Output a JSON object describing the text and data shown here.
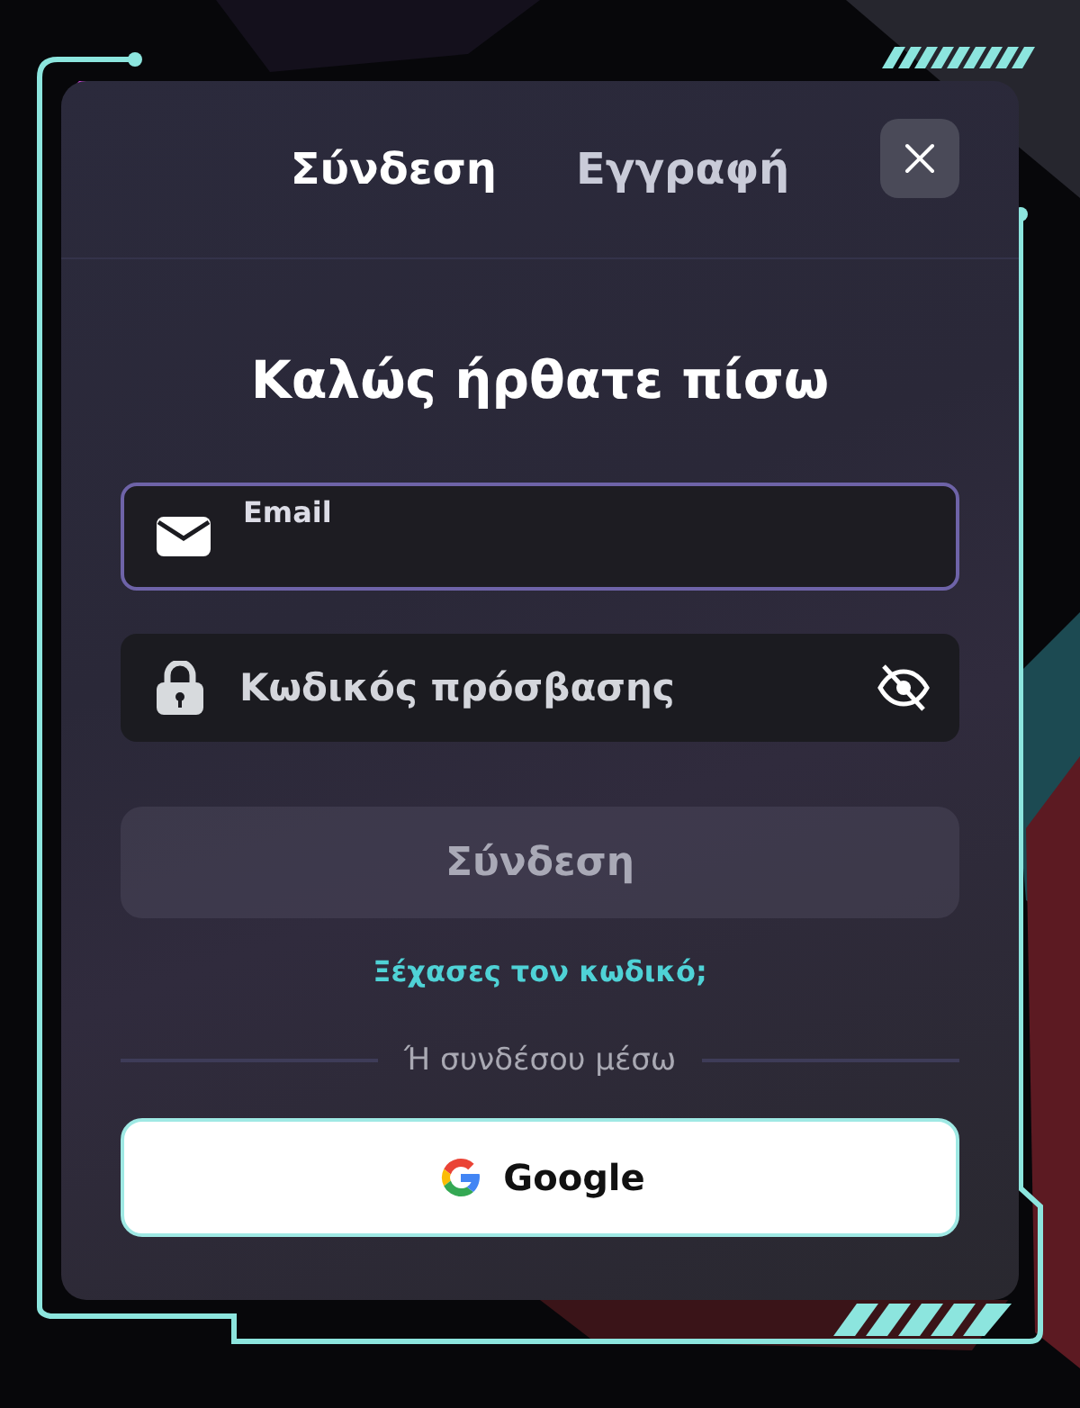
{
  "tabs": [
    {
      "label": "Σύνδεση",
      "selected": true
    },
    {
      "label": "Εγγραφή",
      "selected": false
    }
  ],
  "title": "Καλώς ήρθατε πίσω",
  "fields": [
    {
      "kind": "email",
      "label": "Email",
      "focused": true
    },
    {
      "kind": "password",
      "placeholder": "Κωδικός πρόσβασης",
      "focused": false,
      "password_visible": false
    }
  ],
  "submit": {
    "label": "Σύνδεση",
    "disabled": true
  },
  "forgot_link": "Ξέχασες τον κωδικό;",
  "divider_text": "Ή συνδέσου μέσω",
  "social_buttons": [
    {
      "kind": "google",
      "label": "Google"
    }
  ]
}
